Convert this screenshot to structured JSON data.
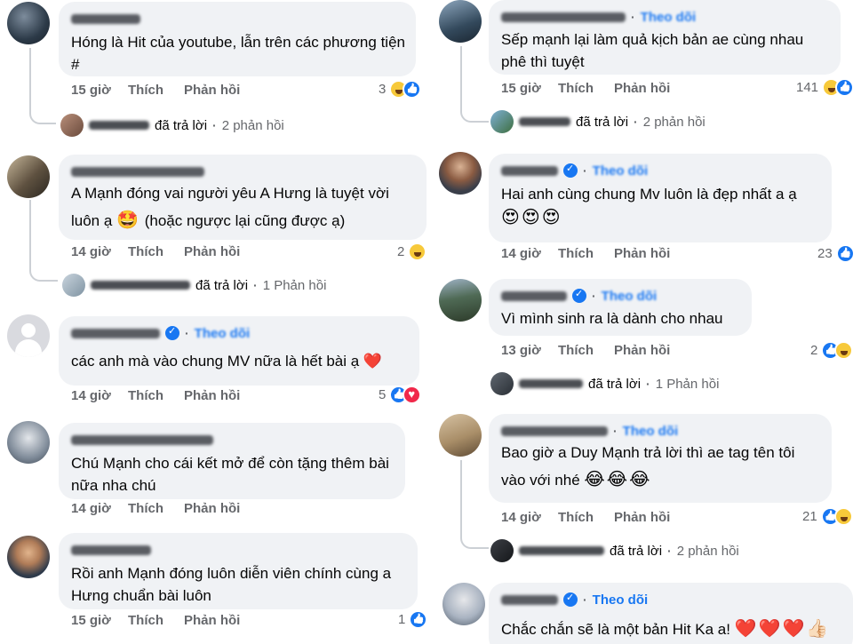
{
  "labels": {
    "like": "Thích",
    "reply": "Phản hồi",
    "follow": "Theo dõi",
    "replied": "đã trả lời",
    "dot": "·"
  },
  "left": [
    {
      "text": "Hóng là Hit của youtube, lẫn trên các phương tiện #",
      "time": "15 giờ",
      "count": "3",
      "reactions": [
        "haha",
        "like"
      ],
      "reply_count": "2 phản hồi"
    },
    {
      "text1": "A Mạnh đóng vai người yêu A Hưng là tuyệt vời",
      "text2": "luôn ạ",
      "emoji": "🤩",
      "text3": "(hoặc ngược lại cũng được ạ)",
      "time": "14 giờ",
      "count": "2",
      "reactions": [
        "haha"
      ],
      "reply_count": "1 Phản hồi"
    },
    {
      "text": "các anh mà vào chung MV nữa là hết bài ạ",
      "heart": "❤️",
      "time": "14 giờ",
      "count": "5",
      "reactions": [
        "like",
        "love"
      ]
    },
    {
      "text": "Chú Mạnh cho cái kết mở để còn tặng thêm bài nữa nha chú",
      "time": "14 giờ"
    },
    {
      "text": "Rồi anh Mạnh đóng luôn diễn viên chính cùng a Hưng chuẩn bài luôn",
      "time": "15 giờ",
      "count": "1",
      "reactions": [
        "like"
      ]
    }
  ],
  "right": [
    {
      "text": "Sếp mạnh lại làm quả kịch bản ae cùng nhau phê thì tuyệt",
      "time": "15 giờ",
      "count": "141",
      "reactions": [
        "haha",
        "like"
      ],
      "reply_count": "2 phản hồi"
    },
    {
      "text": "Hai anh cùng chung Mv luôn là đẹp nhất a ạ",
      "emoji": "😍😍😍",
      "time": "14 giờ",
      "count": "23",
      "reactions": [
        "like"
      ]
    },
    {
      "text": "Vì mình sinh ra là dành cho nhau",
      "time": "13 giờ",
      "count": "2",
      "reactions": [
        "like",
        "haha"
      ],
      "reply_count": "1 Phản hồi"
    },
    {
      "text1": "Bao giờ a Duy Mạnh trả lời thì ae tag tên tôi",
      "text2": "vào với nhé",
      "emoji": "😂😂😂",
      "time": "14 giờ",
      "count": "21",
      "reactions": [
        "like",
        "haha"
      ],
      "reply_count": "2 phản hồi"
    },
    {
      "text": "Chắc chắn sẽ là một bản Hit Ka a!",
      "emoji": "❤️❤️❤️👍🏻"
    }
  ],
  "colors": {
    "bubble": "#f0f2f5",
    "meta": "#65676b",
    "accent": "#1877f2"
  }
}
